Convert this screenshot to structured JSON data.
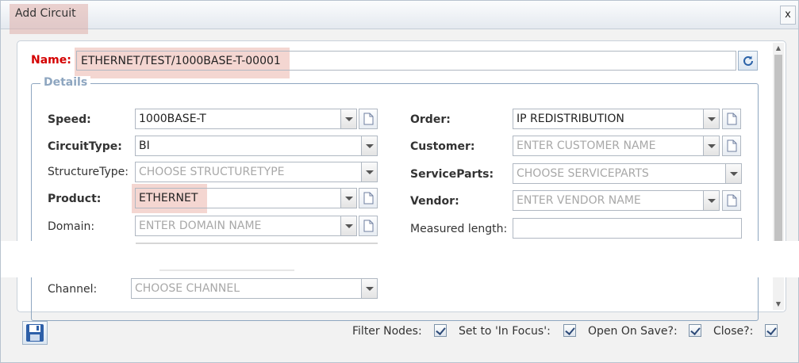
{
  "dialog": {
    "title": "Add Circuit",
    "close_label": "x"
  },
  "name": {
    "label": "Name:",
    "value": "ETHERNET/TEST/1000BASE-T-00001"
  },
  "details": {
    "legend": "Details",
    "left": {
      "speed": {
        "label": "Speed:",
        "value": "1000BASE-T"
      },
      "circuit_type": {
        "label": "CircuitType:",
        "value": "BI"
      },
      "structure_type": {
        "label": "StructureType:",
        "placeholder": "CHOOSE STRUCTURETYPE"
      },
      "product": {
        "label": "Product:",
        "value": "ETHERNET"
      },
      "domain": {
        "label": "Domain:",
        "placeholder": "ENTER DOMAIN NAME"
      },
      "channel": {
        "label": "Channel:",
        "placeholder": "CHOOSE CHANNEL"
      }
    },
    "right": {
      "order": {
        "label": "Order:",
        "value": "IP REDISTRIBUTION"
      },
      "customer": {
        "label": "Customer:",
        "placeholder": "ENTER CUSTOMER NAME"
      },
      "service_parts": {
        "label": "ServiceParts:",
        "placeholder": "CHOOSE SERVICEPARTS"
      },
      "vendor": {
        "label": "Vendor:",
        "placeholder": "ENTER VENDOR NAME"
      },
      "measured_length": {
        "label": "Measured length:",
        "value": ""
      }
    }
  },
  "footer": {
    "filter_nodes": {
      "label": "Filter Nodes:",
      "checked": true
    },
    "set_in_focus": {
      "label": "Set to 'In Focus':",
      "checked": true
    },
    "open_on_save": {
      "label": "Open On Save?:",
      "checked": true
    },
    "close": {
      "label": "Close?:",
      "checked": true
    }
  },
  "icons": {
    "close": "close-icon",
    "refresh": "refresh-icon",
    "document": "document-icon",
    "dropdown": "chevron-down-icon",
    "save": "floppy-disk-icon",
    "check": "checkmark-icon"
  },
  "colors": {
    "required_label": "#d40000",
    "legend": "#8ea6c0",
    "highlight": "#ebb4ac"
  }
}
